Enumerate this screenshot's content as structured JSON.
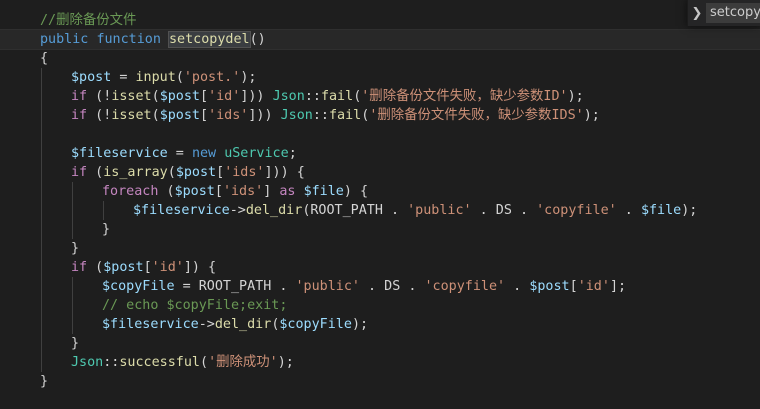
{
  "find": {
    "query": "setcopydel"
  },
  "code": {
    "l1_comment": "//删除备份文件",
    "l2_public": "public",
    "l2_function": "function",
    "l2_name": "setcopydel",
    "l2_parens": "()",
    "l3_brace": "{",
    "l4_var": "$post",
    "l4_eq": " = ",
    "l4_fn": "input",
    "l4_open": "(",
    "l4_str": "'post.'",
    "l4_close": ");",
    "l5_if": "if",
    "l5_p1": " (!",
    "l5_isset": "isset",
    "l5_p2": "(",
    "l5_var": "$post",
    "l5_b1": "[",
    "l5_key": "'id'",
    "l5_b2": "])) ",
    "l5_cls": "Json",
    "l5_sep": "::",
    "l5_fail": "fail",
    "l5_p3": "(",
    "l5_msg": "'删除备份文件失败，缺少参数ID'",
    "l5_end": ");",
    "l6_if": "if",
    "l6_p1": " (!",
    "l6_isset": "isset",
    "l6_p2": "(",
    "l6_var": "$post",
    "l6_b1": "[",
    "l6_key": "'ids'",
    "l6_b2": "])) ",
    "l6_cls": "Json",
    "l6_sep": "::",
    "l6_fail": "fail",
    "l6_p3": "(",
    "l6_msg": "'删除备份文件失败，缺少参数IDS'",
    "l6_end": ");",
    "l8_var": "$fileservice",
    "l8_eq": " = ",
    "l8_new": "new",
    "l8_cls": "uService",
    "l8_end": ";",
    "l9_if": "if",
    "l9_p1": " (",
    "l9_fn": "is_array",
    "l9_p2": "(",
    "l9_var": "$post",
    "l9_b1": "[",
    "l9_key": "'ids'",
    "l9_end": "])) {",
    "l10_foreach": "foreach",
    "l10_p1": " (",
    "l10_var": "$post",
    "l10_b1": "[",
    "l10_key": "'ids'",
    "l10_b2": "] ",
    "l10_as": "as",
    "l10_sp": " ",
    "l10_file": "$file",
    "l10_end": ") {",
    "l11_var": "$fileservice",
    "l11_arrow": "->",
    "l11_fn": "del_dir",
    "l11_p1": "(ROOT_PATH . ",
    "l11_s1": "'public'",
    "l11_ds": " . DS . ",
    "l11_s2": "'copyfile'",
    "l11_dot": " . ",
    "l11_file": "$file",
    "l11_end": ");",
    "l12_brace": "}",
    "l13_brace": "}",
    "l14_if": "if",
    "l14_p1": " (",
    "l14_var": "$post",
    "l14_b1": "[",
    "l14_key": "'id'",
    "l14_end": "]) {",
    "l15_var": "$copyFile",
    "l15_eq": " = ROOT_PATH . ",
    "l15_s1": "'public'",
    "l15_ds": " . DS . ",
    "l15_s2": "'copyfile'",
    "l15_dot": " . ",
    "l15_post": "$post",
    "l15_b1": "[",
    "l15_key": "'id'",
    "l15_end": "];",
    "l16_comment": "// echo $copyFile;exit;",
    "l17_var": "$fileservice",
    "l17_arrow": "->",
    "l17_fn": "del_dir",
    "l17_p1": "(",
    "l17_arg": "$copyFile",
    "l17_end": ");",
    "l18_brace": "}",
    "l19_cls": "Json",
    "l19_sep": "::",
    "l19_fn": "successful",
    "l19_p1": "(",
    "l19_msg": "'删除成功'",
    "l19_end": ");",
    "l20_brace": "}"
  }
}
